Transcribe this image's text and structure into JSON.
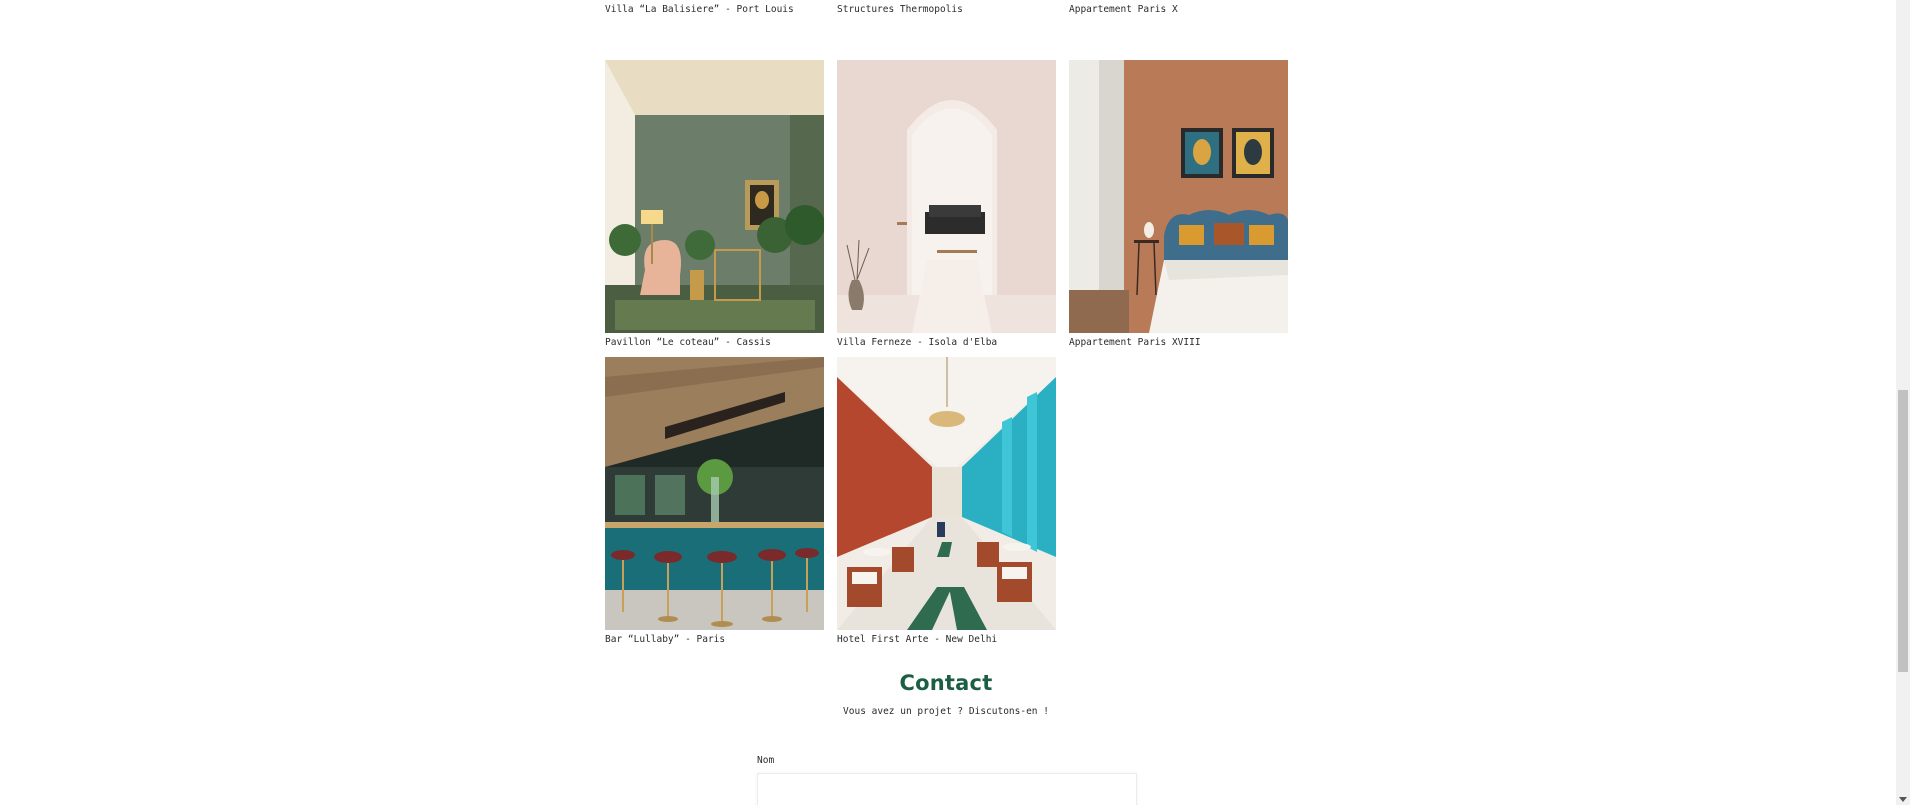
{
  "gallery": {
    "top_row": [
      {
        "caption": "Villa “La Balisiere” - Port Louis"
      },
      {
        "caption": "Structures Thermopolis"
      },
      {
        "caption": "Appartement Paris X"
      }
    ],
    "middle_row": [
      {
        "caption": "Pavillon “Le coteau” - Cassis"
      },
      {
        "caption": "Villa Ferneze - Isola d'Elba"
      },
      {
        "caption": "Appartement Paris XVIII"
      }
    ],
    "bottom_row": [
      {
        "caption": "Bar “Lullaby” - Paris"
      },
      {
        "caption": "Hotel First Arte - New Delhi"
      }
    ]
  },
  "contact": {
    "title": "Contact",
    "subtitle": "Vous avez un projet ? Discutons-en !",
    "name_label": "Nom",
    "name_value": ""
  },
  "colors": {
    "accent": "#1b5e44",
    "text": "#2b2b2b"
  }
}
